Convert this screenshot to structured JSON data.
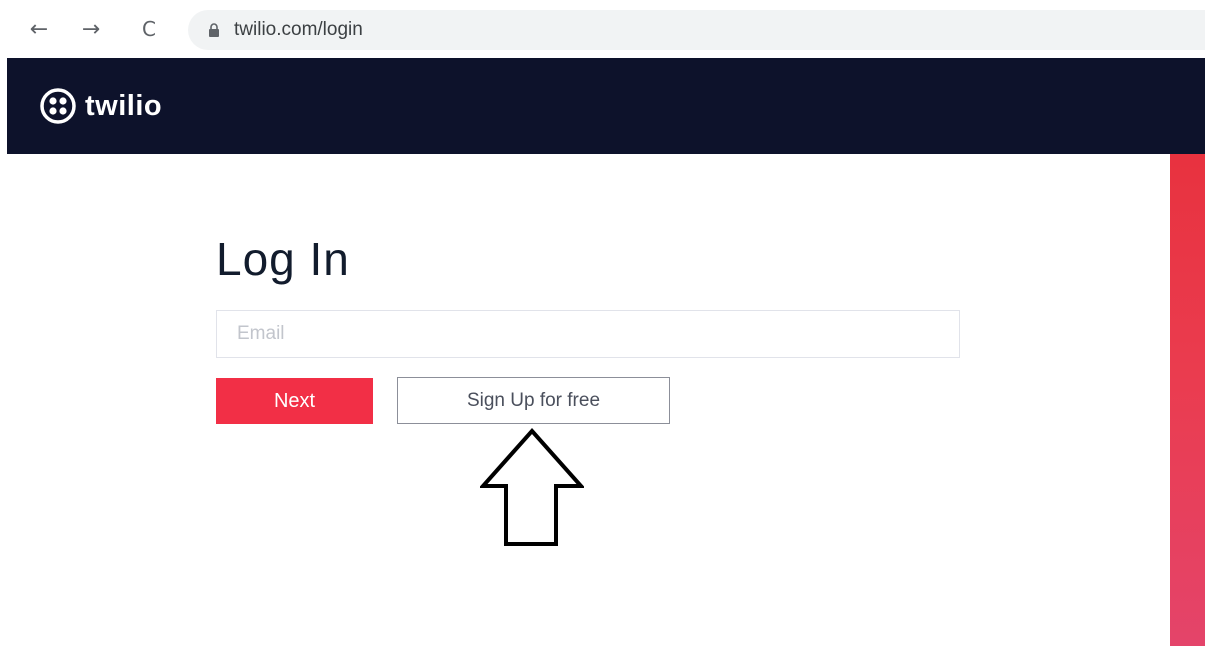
{
  "browser": {
    "url": "twilio.com/login",
    "back_glyph": "←",
    "forward_glyph": "→",
    "reload_glyph": "C"
  },
  "header": {
    "logo_text": "twilio"
  },
  "login": {
    "title": "Log In",
    "email_placeholder": "Email",
    "email_value": "",
    "next_label": "Next",
    "signup_label": "Sign Up for free"
  },
  "icons": {
    "back": "arrow-left-icon",
    "forward": "arrow-right-icon",
    "reload": "reload-icon",
    "lock": "lock-icon",
    "logo": "twilio-logo-icon",
    "annotation": "arrow-up-icon"
  },
  "colors": {
    "header_bg": "#0d122b",
    "accent": "#f22f46",
    "stripe": "#e8323f"
  }
}
